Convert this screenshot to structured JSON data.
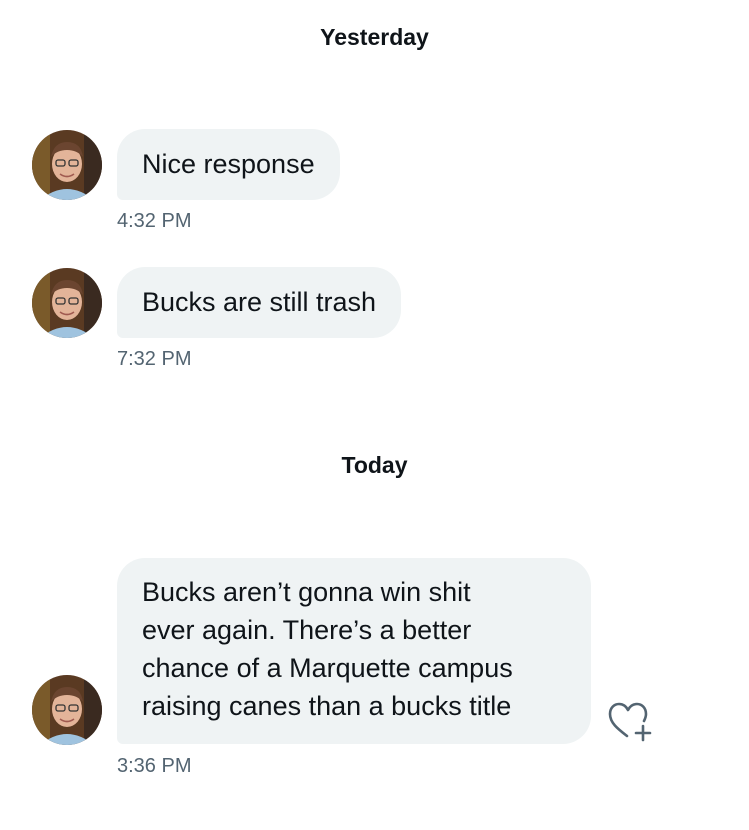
{
  "day_separators": {
    "yesterday": "Yesterday",
    "today": "Today"
  },
  "messages": [
    {
      "text": "Nice response",
      "time": "4:32 PM"
    },
    {
      "text": "Bucks are still trash",
      "time": "7:32 PM"
    },
    {
      "lines": [
        "Bucks aren’t gonna win shit",
        "ever again. There’s a better",
        "chance of a Marquette campus",
        "raising canes than a bucks title"
      ],
      "time": "3:36 PM"
    }
  ],
  "icons": {
    "avatar": "avatar",
    "reaction": "heart-plus-icon"
  },
  "colors": {
    "bubble_bg": "#eff3f4",
    "timestamp": "#536471",
    "text": "#0f1419"
  }
}
